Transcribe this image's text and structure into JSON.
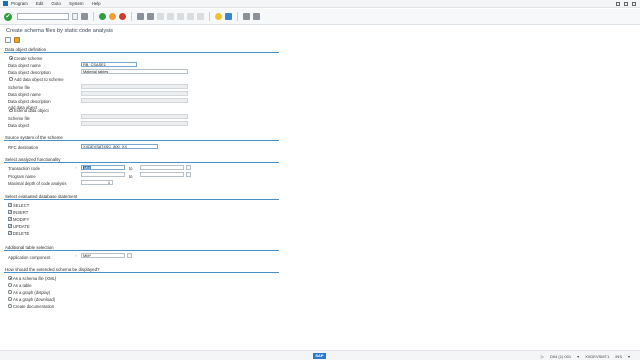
{
  "menu": {
    "items": [
      "Program",
      "Edit",
      "Goto",
      "System",
      "Help"
    ]
  },
  "toolbar": {
    "ok_symbol": "✔"
  },
  "title": "Create schema files by static code analysis",
  "group1": {
    "title": "Data object definition",
    "create_scheme": "Create scheme",
    "data_object_name_label": "Data object name",
    "data_object_name_value": "RB_CSASE1",
    "data_object_desc_label": "Data object description",
    "data_object_desc_value": "Material tables",
    "add_data_object": "Add data object to scheme",
    "scheme_file_label": "Scheme file",
    "data_object_name_label2": "Data object name",
    "data_object_desc_label2": "Data object description",
    "add_data_object_option": "Add data object",
    "extend_data_object": "Extend data object",
    "scheme_file_label2": "Scheme file",
    "data_object_label": "Data object"
  },
  "group2": {
    "title": "Source system of the scheme",
    "rfc_label": "RFC destination",
    "rfc_value": "XXDEVSAT4SC_800_XX"
  },
  "group3": {
    "title": "Select analyzed functionality",
    "tcode_label": "Transaction code",
    "tcode_value": "MM",
    "tcode_suffix": "to",
    "program_label": "Program name",
    "program_suffix": "to",
    "depth_label": "Maximal depth of code analysis",
    "depth_value": "1"
  },
  "group4": {
    "title": "Select evaluated database statement",
    "statements": [
      "SELECT",
      "INSERT",
      "MODIFY",
      "UPDATE",
      "DELETE"
    ]
  },
  "group5": {
    "title": "Additional table selection",
    "app_comp_label": "Application component",
    "app_comp_value": "MM*"
  },
  "group6": {
    "title": "How should the extended schema be displayed?",
    "options": [
      "As a schema file (XML)",
      "As a table",
      "As a graph (display)",
      "As a graph (download)",
      "Create documentation"
    ]
  },
  "status": {
    "logo": "SAP",
    "items": [
      "▷",
      "D04 (1) 001",
      "▾",
      "XXDEVSMT1",
      "INS",
      "▾"
    ]
  },
  "colors": {
    "accent_line": "#4a90c8",
    "sap_blue": "#2a7ad4"
  }
}
